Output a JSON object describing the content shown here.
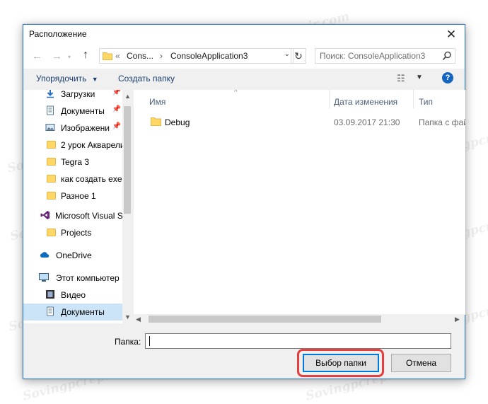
{
  "dialog": {
    "title": "Расположение"
  },
  "navbar": {
    "back_arrow": "←",
    "forward_arrow": "→",
    "up_arrow": "↑",
    "address": {
      "chevron": "«",
      "segments": [
        "Cons...",
        "ConsoleApplication3"
      ],
      "separator": "›"
    },
    "search_placeholder": "Поиск: ConsoleApplication3"
  },
  "toolbar": {
    "organize": "Упорядочить",
    "new_folder": "Создать папку"
  },
  "nav_pane": {
    "items": [
      {
        "label": "Загрузки",
        "icon": "download-icon",
        "pinned": true
      },
      {
        "label": "Документы",
        "icon": "document-icon",
        "pinned": true
      },
      {
        "label": "Изображени",
        "icon": "pictures-icon",
        "pinned": true
      },
      {
        "label": "2 урок Акварели",
        "icon": "folder-icon",
        "pinned": false
      },
      {
        "label": "Tegra 3",
        "icon": "folder-icon",
        "pinned": false
      },
      {
        "label": "как создать exe",
        "icon": "folder-icon",
        "pinned": false
      },
      {
        "label": "Разное 1",
        "icon": "folder-icon",
        "pinned": false
      },
      {
        "label": "Microsoft Visual S",
        "icon": "visual-studio-icon",
        "pinned": false
      },
      {
        "label": "Projects",
        "icon": "folder-icon",
        "pinned": false
      },
      {
        "label": "OneDrive",
        "icon": "onedrive-icon",
        "pinned": false
      },
      {
        "label": "Этот компьютер",
        "icon": "computer-icon",
        "pinned": false
      },
      {
        "label": "Видео",
        "icon": "video-icon",
        "pinned": false
      },
      {
        "label": "Документы",
        "icon": "document-icon",
        "pinned": false,
        "selected": true
      }
    ]
  },
  "file_list": {
    "columns": [
      "Имя",
      "Дата изменения",
      "Тип"
    ],
    "rows": [
      {
        "name": "Debug",
        "date": "03.09.2017 21:30",
        "type": "Папка с фай"
      }
    ]
  },
  "bottom": {
    "folder_label": "Папка:",
    "folder_value": "",
    "select_button": "Выбор папки",
    "cancel_button": "Отмена"
  },
  "watermark": "Sovingpcrepair.com",
  "colors": {
    "accent": "#0078d7",
    "highlight_border": "#e53e3e",
    "selection": "#cce4f7",
    "help": "#1565c0"
  }
}
